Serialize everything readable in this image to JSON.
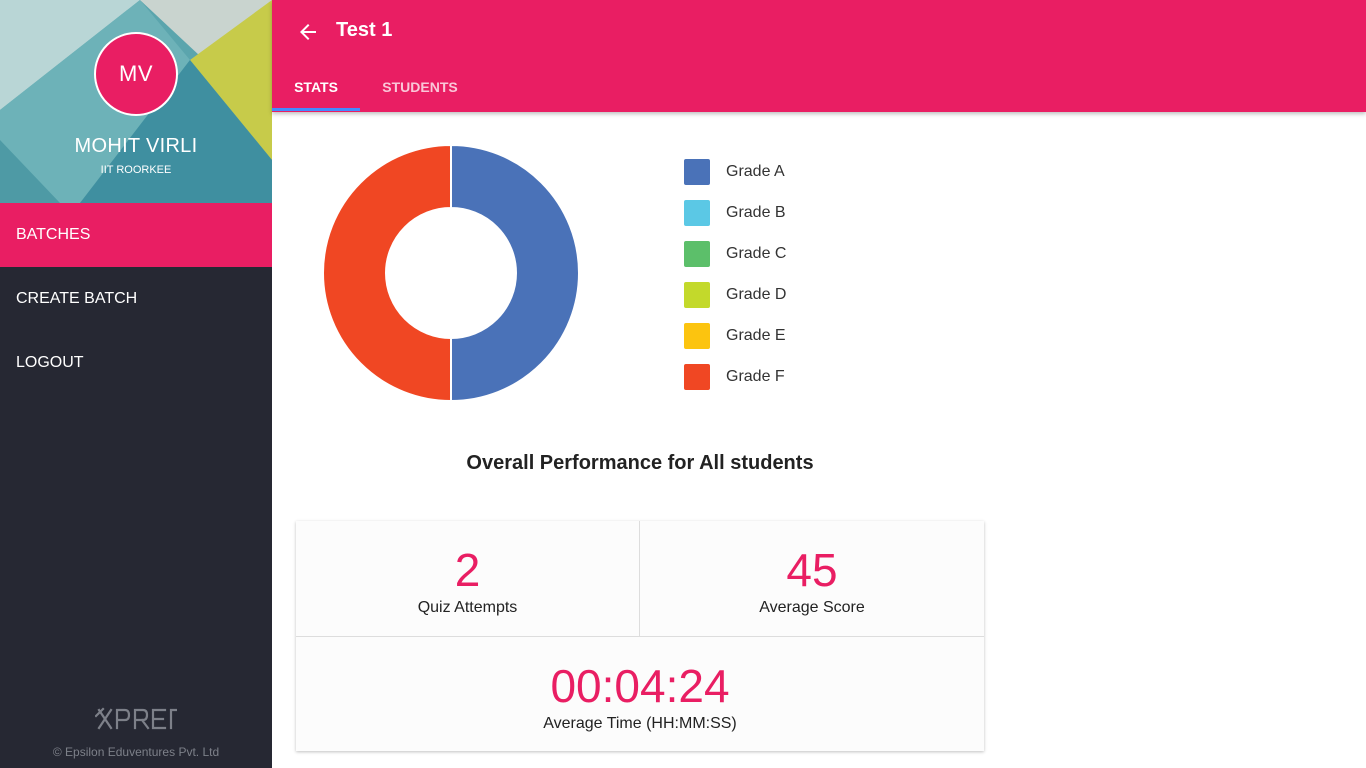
{
  "sidebar": {
    "avatar_initials": "MV",
    "user_name": "MOHIT VIRLI",
    "user_org": "IIT ROORKEE",
    "items": [
      {
        "label": "BATCHES",
        "active": true
      },
      {
        "label": "CREATE BATCH",
        "active": false
      },
      {
        "label": "LOGOUT",
        "active": false
      }
    ],
    "brand_logo": "XPREP",
    "copyright": "© Epsilon Eduventures Pvt. Ltd"
  },
  "header": {
    "back_icon": "arrow-left-icon",
    "title": "Test 1",
    "tabs": [
      {
        "label": "STATS",
        "active": true
      },
      {
        "label": "STUDENTS",
        "active": false
      }
    ]
  },
  "colors": {
    "accent": "#e91e63",
    "sidebar_bg": "#262833",
    "tab_indicator": "#448aff"
  },
  "chart_data": {
    "type": "pie",
    "variant": "donut",
    "categories": [
      "Grade A",
      "Grade B",
      "Grade C",
      "Grade D",
      "Grade E",
      "Grade F"
    ],
    "values": [
      1,
      0,
      0,
      0,
      0,
      1
    ],
    "colors": [
      "#4a72b8",
      "#5bc8e5",
      "#5cbf6a",
      "#c3d92b",
      "#fcc40f",
      "#f04723"
    ],
    "title": "Overall Performance for All students",
    "legend_position": "right"
  },
  "stats": {
    "quiz_attempts": {
      "value": "2",
      "label": "Quiz Attempts"
    },
    "average_score": {
      "value": "45",
      "label": "Average Score"
    },
    "average_time": {
      "value": "00:04:24",
      "label": "Average Time (HH:MM:SS)"
    }
  }
}
